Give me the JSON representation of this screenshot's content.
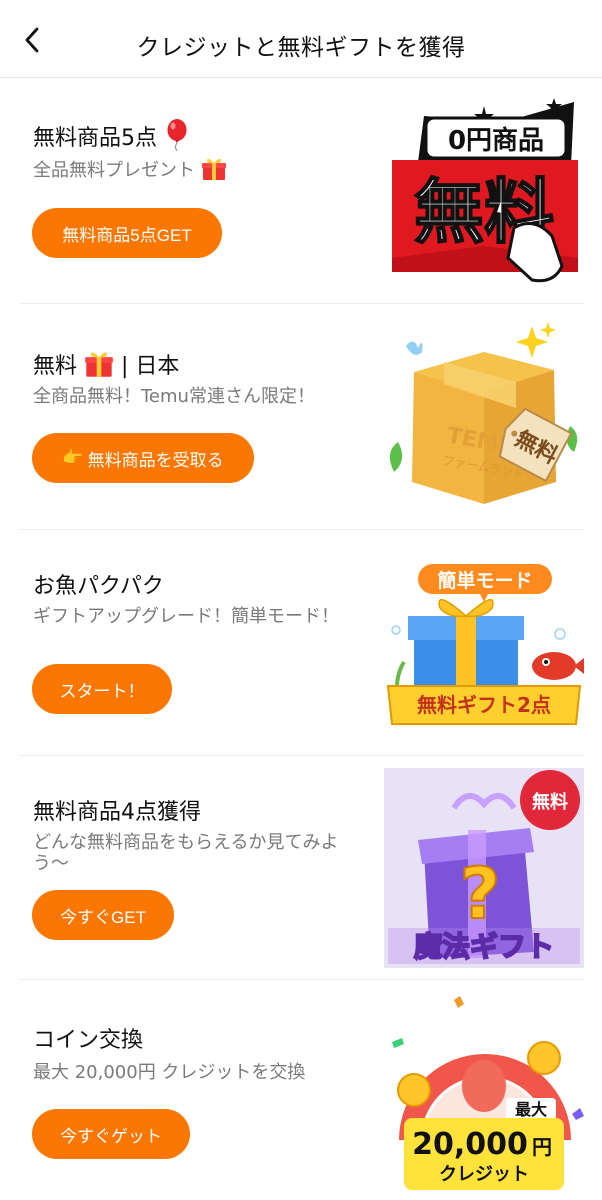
{
  "header": {
    "title": "クレジットと無料ギフトを獲得"
  },
  "cards": [
    {
      "title": "無料商品5点",
      "subtitle": "全品無料プレゼント",
      "button": "無料商品5点GET",
      "art": {
        "badge": "0円商品",
        "big": "無料"
      }
    },
    {
      "title_prefix": "無料",
      "title_suffix": " | 日本",
      "subtitle": "全商品無料！Temu常連さん限定！",
      "button": "無料商品を受取る",
      "button_icon": "👉",
      "art": {
        "box_brand": "TEMU",
        "box_sub": "ファームランド",
        "tag": "無料"
      }
    },
    {
      "title": "お魚パクパク",
      "subtitle": "ギフトアップグレード！簡単モード！",
      "button": "スタート！",
      "art": {
        "bubble": "簡単モード",
        "banner": "無料ギフト2点"
      }
    },
    {
      "title": "無料商品4点獲得",
      "subtitle": "どんな無料商品をもらえるか見てみよう〜",
      "button": "今すぐGET",
      "art": {
        "badge": "無料",
        "mark": "?",
        "caption": "魔法ギフト"
      }
    },
    {
      "title": "コイン交換",
      "subtitle": "最大 20,000円 クレジットを交換",
      "button": "今すぐゲット",
      "art": {
        "max": "最大",
        "amount": "20,000",
        "yen": "円",
        "credit": "クレジット"
      }
    }
  ],
  "colors": {
    "accent": "#fb7701",
    "title": "#111111",
    "subtitle": "#7a7a7a",
    "divider": "#ececec"
  },
  "icons": {
    "back": "chevron-left-icon",
    "balloon": "balloon-icon",
    "gift": "gift-icon"
  }
}
